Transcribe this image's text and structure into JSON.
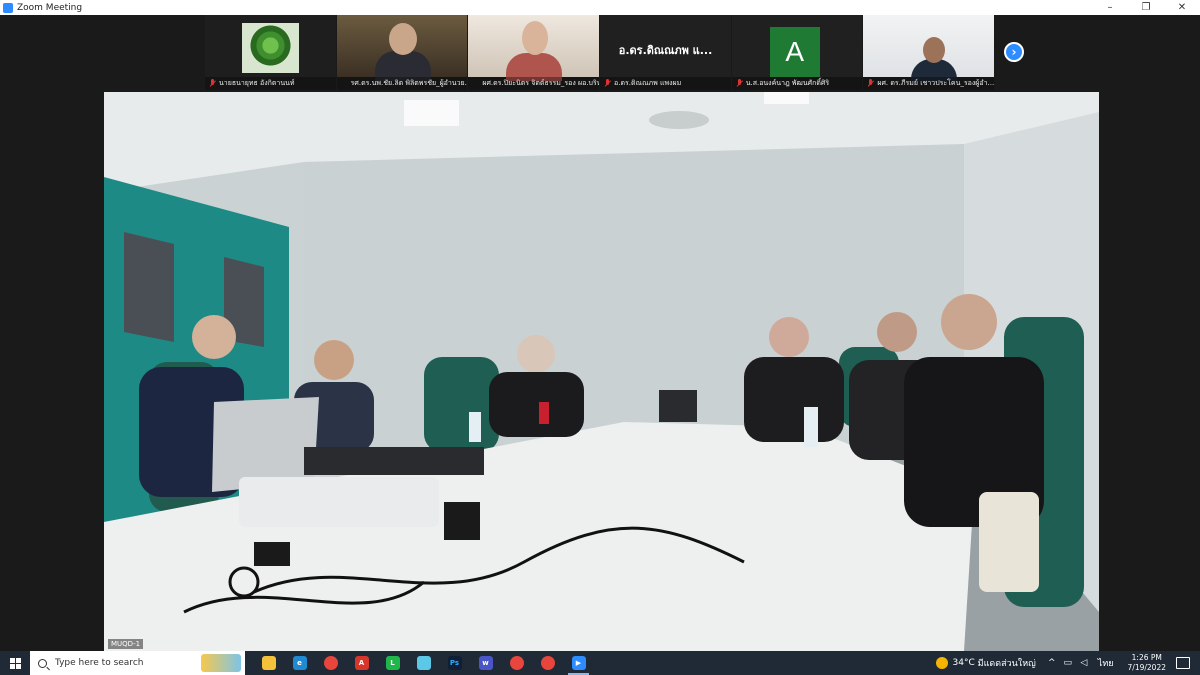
{
  "window": {
    "title": "Zoom Meeting",
    "minimize": "–",
    "restore": "❐",
    "close": "✕"
  },
  "gallery": {
    "tiles": [
      {
        "name": "นายธนายุทธ อังกิตานนท์",
        "muted": true,
        "kind": "plant"
      },
      {
        "name": "รศ.ดร.นพ.ชัย.ลิต พิลิตพรชัย_ผู้อำนวย...",
        "muted": false,
        "kind": "person-a"
      },
      {
        "name": "ผศ.ดร.ปิยะนิตร จิตต์ธรรม_รอง ผอ.บริห...",
        "muted": false,
        "kind": "person-b"
      },
      {
        "name": "อ.ดร.ดิณณภพ แพงผม",
        "muted": true,
        "kind": "name",
        "display_name": "อ.ดร.ดิณณภพ แ..."
      },
      {
        "name": "น.ส.อนงค์นาฎ พัฒนศักดิ์ศิริ",
        "muted": true,
        "kind": "avatar",
        "initial": "A"
      },
      {
        "name": "ผศ. ดร.ภีรมย์ เชาวประโคน_รองผู้อำ...",
        "muted": true,
        "kind": "person-f"
      }
    ],
    "next_arrow": "›"
  },
  "main_video": {
    "connection_label": "MUQD-1"
  },
  "taskbar": {
    "search_placeholder": "Type here to search",
    "weather": {
      "temp": "34°C",
      "desc": "มีแดดส่วนใหญ่"
    },
    "language": "ไทย",
    "time": "1:26 PM",
    "date": "7/19/2022",
    "apps": [
      {
        "name": "file-explorer",
        "glyph": "",
        "bg": "#f3c13a",
        "fg": "#000"
      },
      {
        "name": "edge",
        "glyph": "e",
        "bg": "#1f8ad2",
        "fg": "#fff"
      },
      {
        "name": "chrome",
        "glyph": "",
        "bg": "#e8453c",
        "fg": "#fff"
      },
      {
        "name": "acrobat",
        "glyph": "A",
        "bg": "#d7372b",
        "fg": "#fff"
      },
      {
        "name": "line",
        "glyph": "L",
        "bg": "#1fb64a",
        "fg": "#fff"
      },
      {
        "name": "notepad",
        "glyph": "",
        "bg": "#5ac8e6",
        "fg": "#fff"
      },
      {
        "name": "photoshop",
        "glyph": "Ps",
        "bg": "#0f1f35",
        "fg": "#31a8ff"
      },
      {
        "name": "teams",
        "glyph": "w",
        "bg": "#4a56c6",
        "fg": "#fff"
      },
      {
        "name": "chrome-2",
        "glyph": "",
        "bg": "#e8453c",
        "fg": "#fff"
      },
      {
        "name": "chrome-3",
        "glyph": "",
        "bg": "#e8453c",
        "fg": "#fff"
      },
      {
        "name": "zoom",
        "glyph": "▶",
        "bg": "#2d8cff",
        "fg": "#fff",
        "active": true
      }
    ]
  }
}
